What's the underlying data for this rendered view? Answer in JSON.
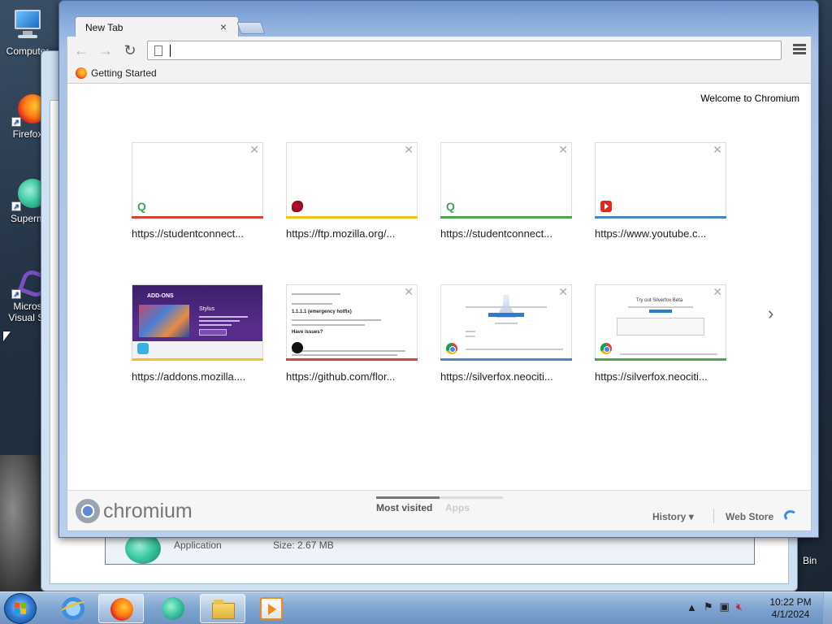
{
  "desktop": {
    "icons": [
      {
        "label": "Computer"
      },
      {
        "label": "Firefox"
      },
      {
        "label": "Superm"
      },
      {
        "label": "Micros Visual St"
      }
    ],
    "recycle_bin_label": "Bin"
  },
  "background_window": {
    "item_type": "Application",
    "item_size": "Size: 2.67 MB"
  },
  "browser": {
    "tab_title": "New Tab",
    "tab_close": "×",
    "address_value": "",
    "bookmarks": [
      {
        "label": "Getting Started"
      }
    ],
    "welcome": "Welcome to Chromium",
    "tiles": [
      {
        "url": "https://studentconnect...",
        "strip_color": "#d9423a",
        "favicon": "q-icon"
      },
      {
        "url": "https://ftp.mozilla.org/...",
        "strip_color": "#f0c419",
        "favicon": "mozilla-dino-icon"
      },
      {
        "url": "https://studentconnect...",
        "strip_color": "#4aa551",
        "favicon": "q-icon"
      },
      {
        "url": "https://www.youtube.c...",
        "strip_color": "#4a86c5",
        "favicon": "youtube-icon"
      },
      {
        "url": "https://addons.mozilla....",
        "strip_color": "#f0c419",
        "favicon": "addons-icon"
      },
      {
        "url": "https://github.com/flor...",
        "strip_color": "#d9423a",
        "favicon": "github-icon"
      },
      {
        "url": "https://silverfox.neociti...",
        "strip_color": "#4a86c5",
        "favicon": "chrome-icon"
      },
      {
        "url": "https://silverfox.neociti...",
        "strip_color": "#4aa551",
        "favicon": "chrome-icon"
      }
    ],
    "thumb_text": {
      "addons_brand": "ADD-ONS",
      "addons_title": "Stylus",
      "github_title": "1.1.1.1 (emergency hotfix)",
      "github_issues": "Have issues?",
      "silverfox_title": "Try out Silverfox Beta"
    },
    "footer": {
      "brand": "chromium",
      "most_visited": "Most visited",
      "apps": "Apps",
      "history": "History",
      "web_store": "Web Store"
    }
  },
  "taskbar": {
    "clock_time": "10:22 PM",
    "clock_date": "4/1/2024"
  }
}
